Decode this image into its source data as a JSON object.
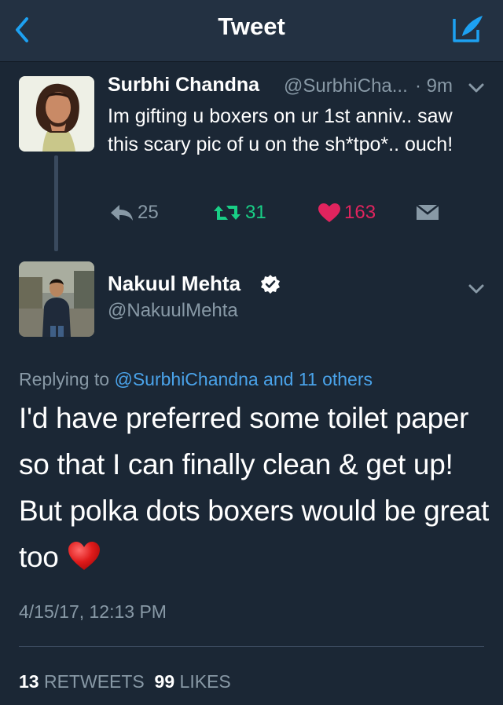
{
  "header": {
    "title": "Tweet"
  },
  "reply_tweet": {
    "name": "Surbhi Chandna",
    "handle": "@SurbhiCha...",
    "time": "· 9m",
    "text": "Im gifting u boxers on ur 1st anniv.. saw this scary pic of u on the sh*tpo*.. ouch!",
    "reply_count": "25",
    "retweet_count": "31",
    "like_count": "163"
  },
  "main_tweet": {
    "name": "Nakuul Mehta",
    "handle": "@NakuulMehta",
    "replying_prefix": "Replying to",
    "replying_targets": "@SurbhiChandna and 11 others",
    "text": "I'd have preferred some toilet paper so that I can finally clean & get up! But polka dots boxers would be great too",
    "timestamp": "4/15/17, 12:13 PM",
    "retweets_count": "13",
    "retweets_label": "RETWEETS",
    "likes_count": "99",
    "likes_label": "LIKES"
  },
  "icons": {
    "back": "chevron-left-icon",
    "compose": "compose-icon",
    "reply": "reply-icon",
    "retweet": "retweet-icon",
    "like": "heart-icon",
    "dm": "direct-message-icon",
    "verified": "verified-badge-icon",
    "emoji": "red-heart-emoji"
  },
  "colors": {
    "background": "#1b2735",
    "header": "#233142",
    "accent": "#1da1f2",
    "retweet": "#19cf86",
    "like": "#e0245e",
    "muted": "#8899a6"
  }
}
